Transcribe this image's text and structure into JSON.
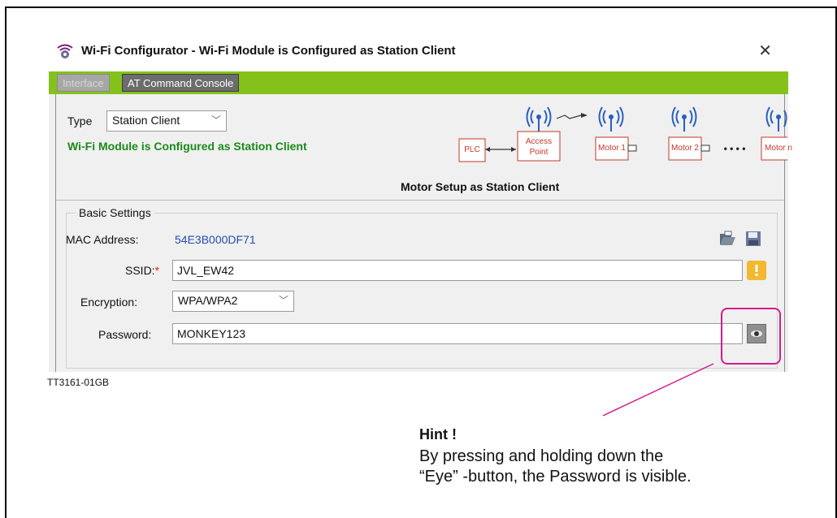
{
  "window": {
    "title": "Wi-Fi Configurator - Wi-Fi Module is Configured as Station Client",
    "close_glyph": "✕"
  },
  "tabs": [
    {
      "label": "Interface",
      "state": "disabled"
    },
    {
      "label": "AT Command Console",
      "state": "active"
    }
  ],
  "interface": {
    "type_label": "Type",
    "type_value": "Station Client",
    "status_message": "Wi-Fi Module is Configured as Station Client"
  },
  "diagram": {
    "nodes": [
      "PLC",
      "Access Point",
      "Motor 1",
      "Motor 2",
      "Motor n"
    ],
    "ellipsis": "• • • •",
    "caption": "Motor Setup as Station Client"
  },
  "basic_settings": {
    "legend": "Basic Settings",
    "mac_label": "MAC Address:",
    "mac_value": "54E3B000DF71",
    "ssid_label": "SSID:",
    "ssid_required_mark": "*",
    "ssid_value": "JVL_EW42",
    "encryption_label": "Encryption:",
    "encryption_value": "WPA/WPA2",
    "password_label": "Password:",
    "password_value": "MONKEY123"
  },
  "icons": {
    "app": "gear-wifi-icon",
    "open": "open-folder-icon",
    "save": "save-floppy-icon",
    "warning": "warning-icon",
    "eye": "eye-icon"
  },
  "colors": {
    "tab_bar": "#84c21b",
    "status_green": "#1a8a1a",
    "mac_blue": "#1f4fb0",
    "highlight_magenta": "#d41c8c",
    "diagram_red": "#c0392b"
  },
  "annotation": {
    "figure_id": "TT3161-01GB",
    "hint_title": "Hint !",
    "hint_line1": "By pressing and holding down the",
    "hint_line2": "“Eye” -button, the Password is visible."
  }
}
